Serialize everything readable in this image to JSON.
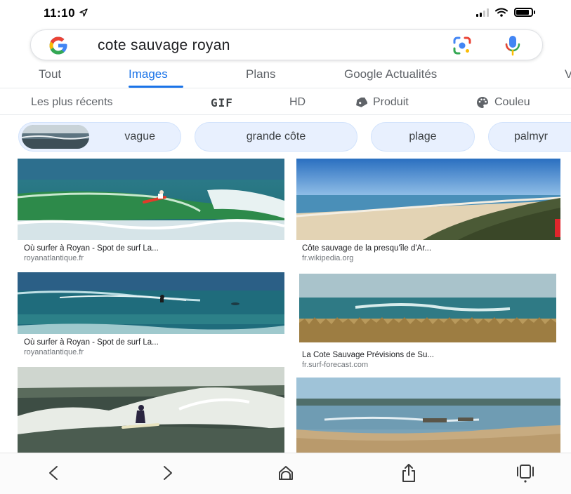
{
  "status_bar": {
    "time": "11:10",
    "location_icon": "location-arrow-icon",
    "signal_icon": "cellular-signal-icon",
    "wifi_icon": "wifi-icon",
    "battery_icon": "battery-icon",
    "battery_level": 0.85
  },
  "search": {
    "logo_icon": "google-g-icon",
    "query": "cote sauvage royan",
    "lens_icon": "google-lens-icon",
    "mic_icon": "microphone-icon"
  },
  "tabs": [
    {
      "label": "Tout"
    },
    {
      "label": "Images",
      "active": true
    },
    {
      "label": "Plans"
    },
    {
      "label": "Google Actualités"
    },
    {
      "label": "V"
    }
  ],
  "filters": [
    {
      "label": "Les plus récents"
    },
    {
      "label": "GIF"
    },
    {
      "label": "HD"
    },
    {
      "label": "Produit",
      "icon": "tag-icon"
    },
    {
      "label": "Couleu",
      "icon": "palette-icon"
    }
  ],
  "chips": [
    {
      "label": "vague"
    },
    {
      "label": "grande côte"
    },
    {
      "label": "plage"
    },
    {
      "label": "palmyr"
    }
  ],
  "results": [
    {
      "title": "Où surfer à Royan - Spot de surf La...",
      "source": "royanatlantique.fr"
    },
    {
      "title": "Côte sauvage de la presqu'île d'Ar...",
      "source": "fr.wikipedia.org"
    },
    {
      "title": "Où surfer à Royan - Spot de surf La...",
      "source": "royanatlantique.fr"
    },
    {
      "title": "La Cote Sauvage Prévisions de Su...",
      "source": "fr.surf-forecast.com"
    },
    {
      "title": "",
      "source": ""
    },
    {
      "title": "",
      "source": ""
    }
  ],
  "bottom_bar": {
    "back_icon": "back-chevron-icon",
    "forward_icon": "forward-chevron-icon",
    "home_icon": "home-icon",
    "share_icon": "share-icon",
    "tabs_icon": "tabs-icon"
  },
  "colors": {
    "accent": "#1a73e8",
    "chip_bg": "#e8f0fe",
    "muted_text": "#5f6368"
  }
}
